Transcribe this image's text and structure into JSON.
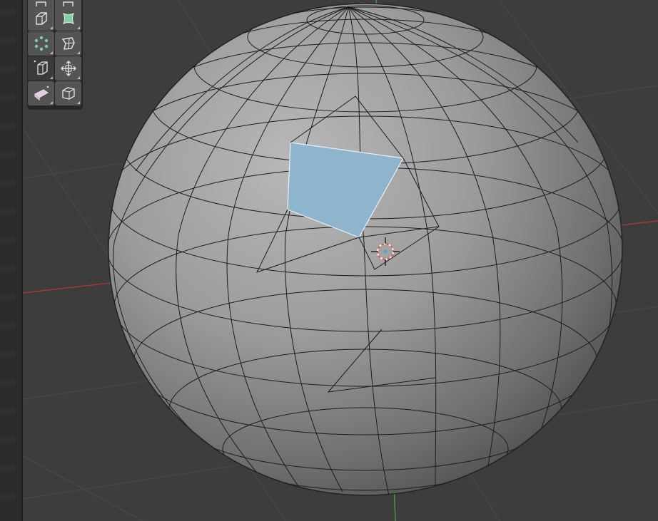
{
  "app": {
    "viewport": {
      "background": "#3d3d3d",
      "grid_line_color": "#4a4a4a",
      "x_axis_color": "#a33a3a",
      "y_axis_color": "#3ea33e",
      "mesh_face_color": "#9a9a9a",
      "mesh_edge_color": "#1a1a1a",
      "selected_face_color": "#8fb5cc",
      "cursor_color": "#e05a4a"
    },
    "toolbar": {
      "tools": [
        {
          "name": "shrink-fatten-tool",
          "icon": "shrink-fatten-icon",
          "active": false
        },
        {
          "name": "push-pull-tool",
          "icon": "push-pull-icon",
          "active": false
        },
        {
          "name": "extrude-region-tool",
          "icon": "extrude-region-icon",
          "active": false
        },
        {
          "name": "inset-faces-tool",
          "icon": "inset-faces-icon",
          "active": false
        },
        {
          "name": "smooth-tool",
          "icon": "smooth-vertices-icon",
          "active": false
        },
        {
          "name": "randomize-tool",
          "icon": "randomize-icon",
          "active": false
        },
        {
          "name": "edge-slide-tool",
          "icon": "edge-slide-icon",
          "active": true
        },
        {
          "name": "move-tool",
          "icon": "move-icon",
          "active": false
        },
        {
          "name": "shear-tool",
          "icon": "shear-icon",
          "active": false
        },
        {
          "name": "to-sphere-tool",
          "icon": "to-sphere-icon",
          "active": false
        }
      ]
    }
  }
}
